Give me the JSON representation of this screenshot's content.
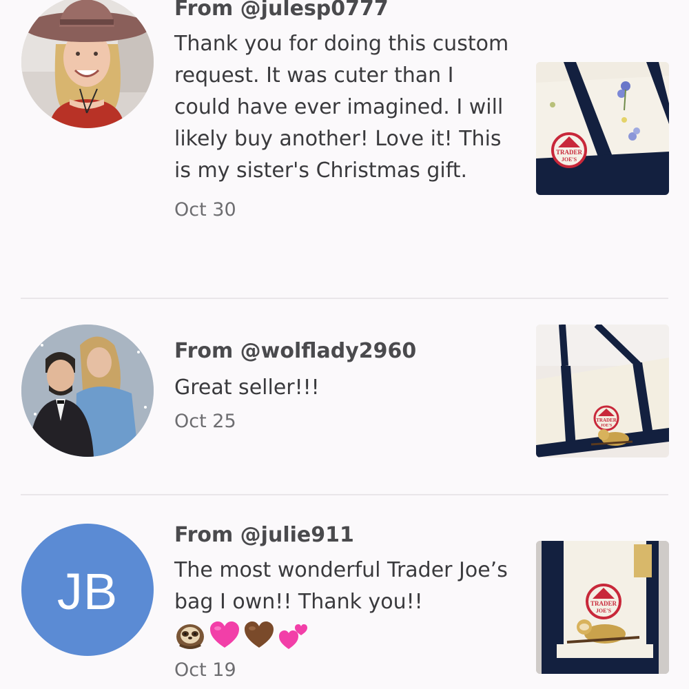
{
  "reviews": [
    {
      "from": "From @julesp0777",
      "body": "Thank you for doing this custom request. It was cuter than I could have ever imagined. I will likely buy another! Love it! This is my sister's Christmas gift.",
      "date": "Oct 30",
      "avatar_icon": "person-photo-avatar",
      "photo_icon": "tote-bag-photo"
    },
    {
      "from": "From @wolflady2960",
      "body": "Great seller!!!",
      "date": "Oct 25",
      "avatar_icon": "couple-photo-avatar",
      "photo_icon": "tote-bag-photo"
    },
    {
      "from": "From @julie911",
      "body": "The most wonderful Trader Joe’s bag I own!! Thank you!!",
      "date": "Oct 19",
      "avatar_initials": "JB",
      "avatar_color": "#5b8bd4",
      "emojis": [
        "sloth",
        "pink-heart",
        "brown-heart",
        "two-hearts"
      ],
      "photo_icon": "tote-bag-photo"
    }
  ],
  "logo_text": "TRADER JOE'S",
  "colors": {
    "background": "#fbf9fb",
    "text": "#3a3a3d",
    "divider": "#e9e6e9",
    "tote_navy": "#13203f",
    "tote_canvas": "#f3eee4",
    "logo_red": "#c8283a"
  }
}
